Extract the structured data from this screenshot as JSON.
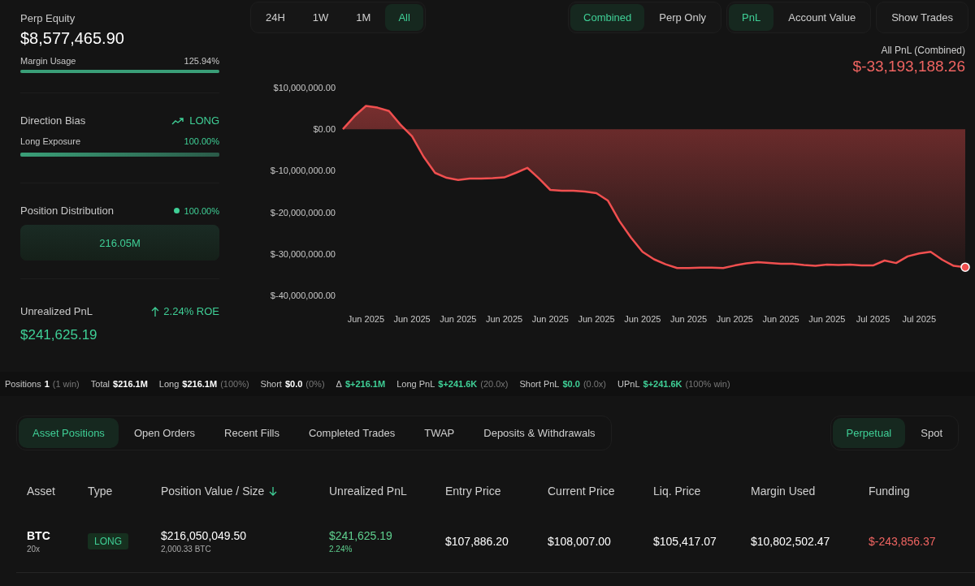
{
  "summary": {
    "perp_equity": {
      "label": "Perp Equity",
      "value": "$8,577,465.90"
    },
    "margin_usage": {
      "label": "Margin Usage",
      "reading": "125.94%",
      "level": 1
    },
    "direction_bias": {
      "label": "Direction Bias",
      "value": "LONG"
    },
    "long_exposure": {
      "label": "Long Exposure",
      "reading": "100.00%",
      "level": 1
    },
    "position_distribution": {
      "label": "Position Distribution",
      "reading": "100.00%",
      "bar_label": "216.05M",
      "level": 1
    },
    "unrealized_pnl": {
      "label": "Unrealized PnL",
      "roe": "2.24% ROE",
      "value": "$241,625.19"
    }
  },
  "chart_controls": {
    "ranges": [
      {
        "label": "24H",
        "selected": false
      },
      {
        "label": "1W",
        "selected": false
      },
      {
        "label": "1M",
        "selected": false
      },
      {
        "label": "All",
        "selected": true
      }
    ],
    "modes": [
      {
        "label": "Combined",
        "selected": true
      },
      {
        "label": "Perp Only",
        "selected": false
      }
    ],
    "metrics": [
      {
        "label": "PnL",
        "selected": true
      },
      {
        "label": "Account Value",
        "selected": false
      }
    ],
    "show_trades": "Show Trades"
  },
  "pnl_panel": {
    "caption": "All PnL (Combined)",
    "total": "$-33,193,188.26",
    "chart_data": {
      "type": "area",
      "categories": [
        null,
        null,
        "Jun 2025",
        null,
        null,
        null,
        "Jun 2025",
        null,
        null,
        null,
        "Jun 2025",
        null,
        null,
        null,
        "Jun 2025",
        null,
        null,
        null,
        "Jun 2025",
        null,
        null,
        null,
        "Jun 2025",
        null,
        null,
        null,
        "Jun 2025",
        null,
        null,
        null,
        "Jun 2025",
        null,
        null,
        null,
        "Jun 2025",
        null,
        null,
        null,
        "Jun 2025",
        null,
        null,
        null,
        "Jun 2025",
        null,
        null,
        null,
        "Jul 2025",
        null,
        null,
        null,
        "Jul 2025",
        null,
        null,
        null,
        null
      ],
      "series": [
        {
          "color": "#f04f4f",
          "values": [
            0,
            3100000,
            5600000,
            5200000,
            4400000,
            1100000,
            -1700000,
            -6600000,
            -10500000,
            -11700000,
            -12200000,
            -11900000,
            -11900000,
            -11800000,
            -11600000,
            -10500000,
            -9300000,
            -11800000,
            -14600000,
            -14800000,
            -14800000,
            -15000000,
            -15400000,
            -17200000,
            -22100000,
            -26100000,
            -29500000,
            -31300000,
            -32500000,
            -33400000,
            -33400000,
            -33300000,
            -33300000,
            -33400000,
            -32800000,
            -32300000,
            -32000000,
            -32200000,
            -32400000,
            -32400000,
            -32700000,
            -32900000,
            -32600000,
            -32700000,
            -32600000,
            -32800000,
            -32800000,
            -31600000,
            -32200000,
            -30600000,
            -29900000,
            -29500000,
            -31400000,
            -32900000,
            -33200000
          ]
        }
      ],
      "ylim": [
        -40000000,
        10000000
      ],
      "yticks": [
        {
          "value": 10000000,
          "label": "$10,000,000.00"
        },
        {
          "value": 0,
          "label": "$0.00"
        },
        {
          "value": -10000000,
          "label": "$-10,000,000.00"
        },
        {
          "value": -20000000,
          "label": "$-20,000,000.00"
        },
        {
          "value": -30000000,
          "label": "$-30,000,000.00"
        },
        {
          "value": -40000000,
          "label": "$-40,000,000.00"
        }
      ]
    }
  },
  "stats_bar": [
    {
      "label": "Positions",
      "value": "1",
      "note": "(1 win)"
    },
    {
      "label": "Total",
      "value": "$216.1M"
    },
    {
      "label": "Long",
      "value": "$216.1M",
      "note": "(100%)"
    },
    {
      "label": "Short",
      "value": "$0.0",
      "note": "(0%)"
    },
    {
      "label": "Δ",
      "value": "$+216.1M",
      "color": "#3fcf96"
    },
    {
      "label": "Long PnL",
      "value": "$+241.6K",
      "note": "(20.0x)",
      "color": "#3fcf96"
    },
    {
      "label": "Short PnL",
      "value": "$0.0",
      "note": "(0.0x)",
      "color": "#3fcf96"
    },
    {
      "label": "UPnL",
      "value": "$+241.6K",
      "note": "(100% win)",
      "color": "#3fcf96"
    }
  ],
  "tabs": [
    {
      "label": "Asset Positions",
      "selected": true
    },
    {
      "label": "Open Orders",
      "selected": false
    },
    {
      "label": "Recent Fills",
      "selected": false
    },
    {
      "label": "Completed Trades",
      "selected": false
    },
    {
      "label": "TWAP",
      "selected": false
    },
    {
      "label": "Deposits & Withdrawals",
      "selected": false
    }
  ],
  "market_tabs": [
    {
      "label": "Perpetual",
      "selected": true
    },
    {
      "label": "Spot",
      "selected": false
    }
  ],
  "table": {
    "columns": [
      {
        "label": "Asset",
        "sorted": false
      },
      {
        "label": "Type",
        "sorted": false
      },
      {
        "label": "Position Value / Size",
        "sorted": true
      },
      {
        "label": "Unrealized PnL",
        "sorted": false
      },
      {
        "label": "Entry Price",
        "sorted": false
      },
      {
        "label": "Current Price",
        "sorted": false
      },
      {
        "label": "Liq. Price",
        "sorted": false
      },
      {
        "label": "Margin Used",
        "sorted": false
      },
      {
        "label": "Funding",
        "sorted": false
      }
    ],
    "rows": [
      {
        "cells": [
          {
            "kind": "asset",
            "main": "BTC",
            "sub": "20x"
          },
          {
            "kind": "badge",
            "main": "LONG"
          },
          {
            "kind": "stack",
            "main": "$216,050,049.50",
            "sub": "2,000.33 BTC"
          },
          {
            "kind": "stack",
            "main": "$241,625.19",
            "sub": "2.24%",
            "color": "#5fd08f"
          },
          {
            "kind": "plain",
            "main": "$107,886.20"
          },
          {
            "kind": "plain",
            "main": "$108,007.00"
          },
          {
            "kind": "plain",
            "main": "$105,417.07"
          },
          {
            "kind": "plain",
            "main": "$10,802,502.47"
          },
          {
            "kind": "plain",
            "main": "$-243,856.37",
            "color": "#ef6461"
          }
        ]
      }
    ]
  }
}
